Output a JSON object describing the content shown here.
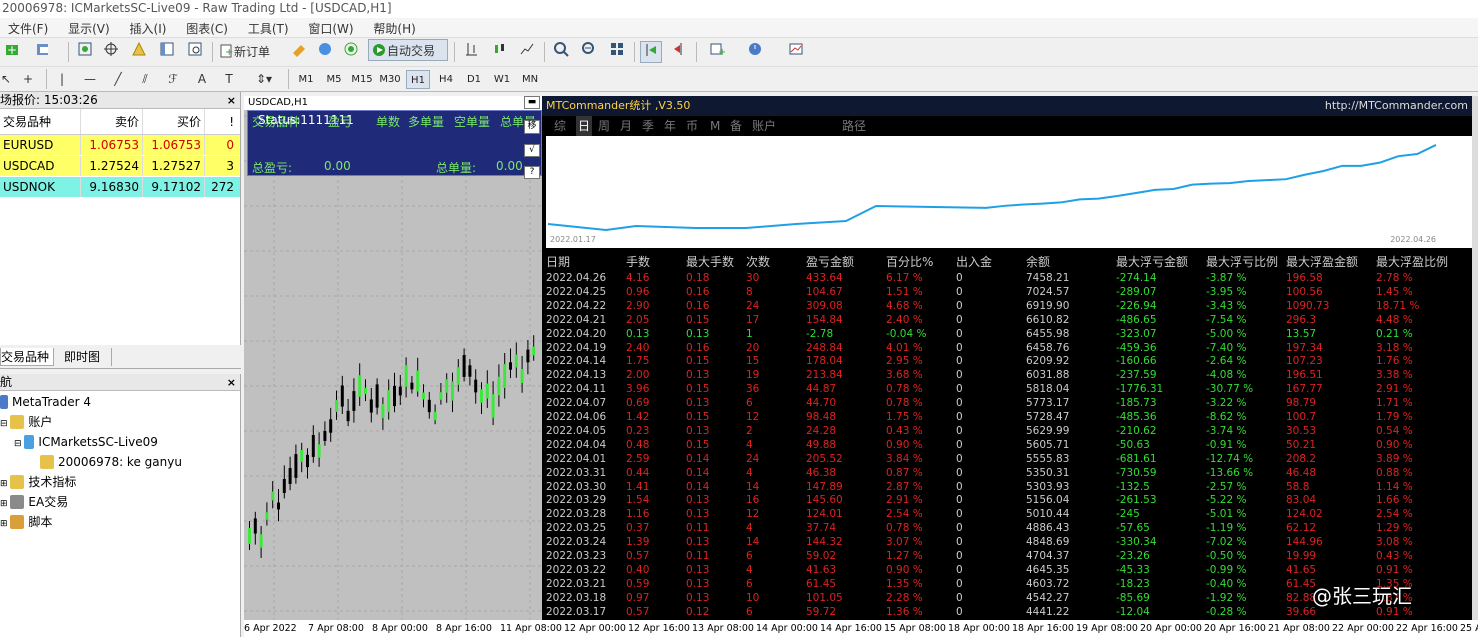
{
  "window": {
    "title": "20006978: ICMarketsSC-Live09 - Raw Trading Ltd - [USDCAD,H1]"
  },
  "menu": [
    "文件(F)",
    "显示(V)",
    "插入(I)",
    "图表(C)",
    "工具(T)",
    "窗口(W)",
    "帮助(H)"
  ],
  "toolbar": {
    "new_order": "新订单",
    "auto_trading": "自动交易"
  },
  "timeframes": [
    "M1",
    "M5",
    "M15",
    "M30",
    "H1",
    "H4",
    "D1",
    "W1",
    "MN"
  ],
  "active_timeframe": "H1",
  "market_watch": {
    "title": "场报价: 15:03:26",
    "headers": {
      "symbol": "交易品种",
      "bid": "卖价",
      "ask": "买价",
      "spread": "!"
    },
    "rows": [
      {
        "symbol": "EURUSD",
        "bid": "1.06753",
        "ask": "1.06753",
        "spread": "0",
        "bg": "#ffff66",
        "color": "#d40000"
      },
      {
        "symbol": "USDCAD",
        "bid": "1.27524",
        "ask": "1.27527",
        "spread": "3",
        "bg": "#ffff66",
        "color": "#000000"
      },
      {
        "symbol": "USDNOK",
        "bid": "9.16830",
        "ask": "9.17102",
        "spread": "272",
        "bg": "#7ff2e6",
        "color": "#000000"
      }
    ],
    "tabs": [
      "交易品种",
      "即时图"
    ]
  },
  "navigator": {
    "title": "航",
    "items": [
      {
        "label": "MetaTrader 4",
        "icon": "metatrader-icon"
      },
      {
        "label": "账户",
        "icon": "accounts-icon"
      },
      {
        "label": "ICMarketsSC-Live09",
        "icon": "server-icon"
      },
      {
        "label": "20006978: ke ganyu",
        "icon": "user-icon"
      },
      {
        "label": "技术指标",
        "icon": "indicators-icon"
      },
      {
        "label": "EA交易",
        "icon": "expert-icon"
      },
      {
        "label": "脚本",
        "icon": "scripts-icon"
      }
    ]
  },
  "chart": {
    "symbol_label": "USDCAD,H1",
    "panel": {
      "status": "Status:1111111",
      "headers": [
        "交易品种",
        "盈亏",
        "单数",
        "多单量",
        "空单量",
        "总单量"
      ],
      "total_pl_label": "总盈亏:",
      "total_pl": "0.00",
      "total_lots_label": "总单量:",
      "total_lots": "0.00"
    },
    "x_labels": [
      "6 Apr 2022",
      "7 Apr 08:00",
      "8 Apr 00:00",
      "8 Apr 16:00",
      "11 Apr 08:00",
      "12 Apr 00:00",
      "12 Apr 16:00",
      "13 Apr 08:00",
      "14 Apr 00:00",
      "14 Apr 16:00",
      "15 Apr 08:00",
      "18 Apr 00:00",
      "18 Apr 16:00",
      "19 Apr 08:00",
      "20 Apr 00:00",
      "20 Apr 16:00",
      "21 Apr 08:00",
      "22 Apr 00:00",
      "22 Apr 16:00",
      "25 A"
    ]
  },
  "stats": {
    "title": "MTCommander统计 ,V3.50",
    "url": "http://MTCommander.com",
    "tabs": [
      "综",
      "日",
      "周",
      "月",
      "季",
      "年",
      "币",
      "M",
      "备",
      "账户",
      "路径"
    ],
    "active_tab": "日",
    "curve": {
      "start_date": "2022.01.17",
      "end_date": "2022.04.26"
    },
    "columns": [
      "日期",
      "手数",
      "最大手数",
      "次数",
      "盈亏金额",
      "百分比%",
      "出入金",
      "余额",
      "最大浮亏金额",
      "最大浮亏比例",
      "最大浮盈金额",
      "最大浮盈比例"
    ],
    "rows": [
      [
        "2022.04.26",
        "4.16",
        "0.18",
        "30",
        "433.64",
        "6.17 %",
        "0",
        "7458.21",
        "-274.14",
        "-3.87 %",
        "196.58",
        "2.78 %"
      ],
      [
        "2022.04.25",
        "0.96",
        "0.16",
        "8",
        "104.67",
        "1.51 %",
        "0",
        "7024.57",
        "-289.07",
        "-3.95 %",
        "100.56",
        "1.45 %"
      ],
      [
        "2022.04.22",
        "2.90",
        "0.16",
        "24",
        "309.08",
        "4.68 %",
        "0",
        "6919.90",
        "-226.94",
        "-3.43 %",
        "1090.73",
        "18.71 %"
      ],
      [
        "2022.04.21",
        "2.05",
        "0.15",
        "17",
        "154.84",
        "2.40 %",
        "0",
        "6610.82",
        "-486.65",
        "-7.54 %",
        "296.3",
        "4.48 %"
      ],
      [
        "2022.04.20",
        "0.13",
        "0.13",
        "1",
        "-2.78",
        "-0.04 %",
        "0",
        "6455.98",
        "-323.07",
        "-5.00 %",
        "13.57",
        "0.21 %"
      ],
      [
        "2022.04.19",
        "2.40",
        "0.16",
        "20",
        "248.84",
        "4.01 %",
        "0",
        "6458.76",
        "-459.36",
        "-7.40 %",
        "197.34",
        "3.18 %"
      ],
      [
        "2022.04.14",
        "1.75",
        "0.15",
        "15",
        "178.04",
        "2.95 %",
        "0",
        "6209.92",
        "-160.66",
        "-2.64 %",
        "107.23",
        "1.76 %"
      ],
      [
        "2022.04.13",
        "2.00",
        "0.13",
        "19",
        "213.84",
        "3.68 %",
        "0",
        "6031.88",
        "-237.59",
        "-4.08 %",
        "196.51",
        "3.38 %"
      ],
      [
        "2022.04.11",
        "3.96",
        "0.15",
        "36",
        "44.87",
        "0.78 %",
        "0",
        "5818.04",
        "-1776.31",
        "-30.77 %",
        "167.77",
        "2.91 %"
      ],
      [
        "2022.04.07",
        "0.69",
        "0.13",
        "6",
        "44.70",
        "0.78 %",
        "0",
        "5773.17",
        "-185.73",
        "-3.22 %",
        "98.79",
        "1.71 %"
      ],
      [
        "2022.04.06",
        "1.42",
        "0.15",
        "12",
        "98.48",
        "1.75 %",
        "0",
        "5728.47",
        "-485.36",
        "-8.62 %",
        "100.7",
        "1.79 %"
      ],
      [
        "2022.04.05",
        "0.23",
        "0.13",
        "2",
        "24.28",
        "0.43 %",
        "0",
        "5629.99",
        "-210.62",
        "-3.74 %",
        "30.53",
        "0.54 %"
      ],
      [
        "2022.04.04",
        "0.48",
        "0.15",
        "4",
        "49.88",
        "0.90 %",
        "0",
        "5605.71",
        "-50.63",
        "-0.91 %",
        "50.21",
        "0.90 %"
      ],
      [
        "2022.04.01",
        "2.59",
        "0.14",
        "24",
        "205.52",
        "3.84 %",
        "0",
        "5555.83",
        "-681.61",
        "-12.74 %",
        "208.2",
        "3.89 %"
      ],
      [
        "2022.03.31",
        "0.44",
        "0.14",
        "4",
        "46.38",
        "0.87 %",
        "0",
        "5350.31",
        "-730.59",
        "-13.66 %",
        "46.48",
        "0.88 %"
      ],
      [
        "2022.03.30",
        "1.41",
        "0.14",
        "14",
        "147.89",
        "2.87 %",
        "0",
        "5303.93",
        "-132.5",
        "-2.57 %",
        "58.8",
        "1.14 %"
      ],
      [
        "2022.03.29",
        "1.54",
        "0.13",
        "16",
        "145.60",
        "2.91 %",
        "0",
        "5156.04",
        "-261.53",
        "-5.22 %",
        "83.04",
        "1.66 %"
      ],
      [
        "2022.03.28",
        "1.16",
        "0.13",
        "12",
        "124.01",
        "2.54 %",
        "0",
        "5010.44",
        "-245",
        "-5.01 %",
        "124.02",
        "2.54 %"
      ],
      [
        "2022.03.25",
        "0.37",
        "0.11",
        "4",
        "37.74",
        "0.78 %",
        "0",
        "4886.43",
        "-57.65",
        "-1.19 %",
        "62.12",
        "1.29 %"
      ],
      [
        "2022.03.24",
        "1.39",
        "0.13",
        "14",
        "144.32",
        "3.07 %",
        "0",
        "4848.69",
        "-330.34",
        "-7.02 %",
        "144.96",
        "3.08 %"
      ],
      [
        "2022.03.23",
        "0.57",
        "0.11",
        "6",
        "59.02",
        "1.27 %",
        "0",
        "4704.37",
        "-23.26",
        "-0.50 %",
        "19.99",
        "0.43 %"
      ],
      [
        "2022.03.22",
        "0.40",
        "0.13",
        "4",
        "41.63",
        "0.90 %",
        "0",
        "4645.35",
        "-45.33",
        "-0.99 %",
        "41.65",
        "0.91 %"
      ],
      [
        "2022.03.21",
        "0.59",
        "0.13",
        "6",
        "61.45",
        "1.35 %",
        "0",
        "4603.72",
        "-18.23",
        "-0.40 %",
        "61.45",
        "1.35 %"
      ],
      [
        "2022.03.18",
        "0.97",
        "0.13",
        "10",
        "101.05",
        "2.28 %",
        "0",
        "4542.27",
        "-85.69",
        "-1.92 %",
        "82.88",
        "1.87 %"
      ],
      [
        "2022.03.17",
        "0.57",
        "0.12",
        "6",
        "59.72",
        "1.36 %",
        "0",
        "4441.22",
        "-12.04",
        "-0.28 %",
        "39.66",
        "0.91 %"
      ]
    ]
  },
  "watermark": "@张三玩汇"
}
